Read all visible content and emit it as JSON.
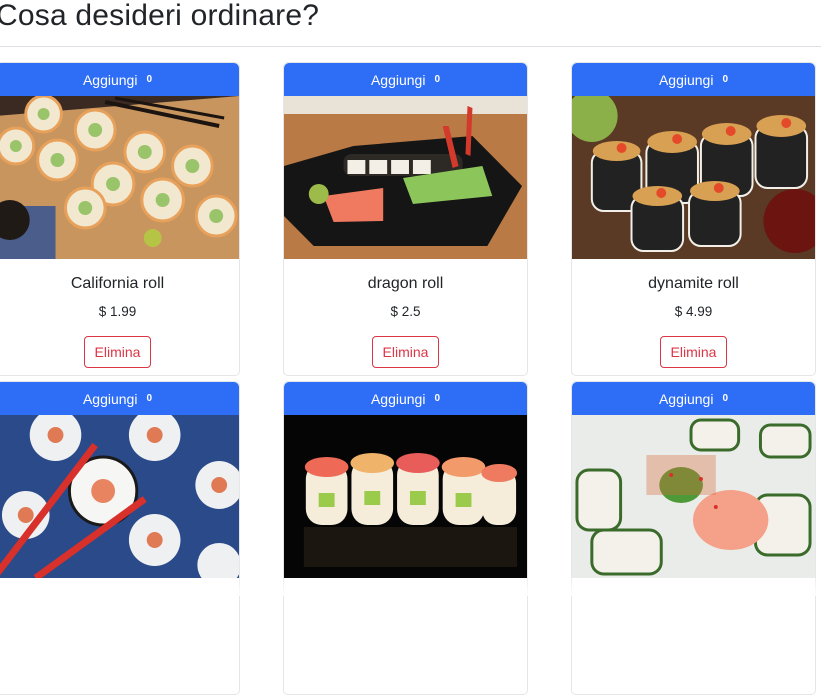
{
  "page": {
    "title": "Cosa desideri ordinare?"
  },
  "products": [
    {
      "add_label": "Aggiungi",
      "count": "0",
      "name": "California roll",
      "price": "$ 1.99",
      "delete_label": "Elimina",
      "image": "california-roll-photo"
    },
    {
      "add_label": "Aggiungi",
      "count": "0",
      "name": "dragon roll",
      "price": "$ 2.5",
      "delete_label": "Elimina",
      "image": "dragon-roll-photo"
    },
    {
      "add_label": "Aggiungi",
      "count": "0",
      "name": "dynamite roll",
      "price": "$ 4.99",
      "delete_label": "Elimina",
      "image": "dynamite-roll-photo"
    },
    {
      "add_label": "Aggiungi",
      "count": "0",
      "image": "hand-roll-chopsticks-photo"
    },
    {
      "add_label": "Aggiungi",
      "count": "0",
      "image": "rainbow-roll-photo"
    },
    {
      "add_label": "Aggiungi",
      "count": "0",
      "image": "shrimp-roll-photo"
    }
  ],
  "colors": {
    "primary": "#2e6df6",
    "danger": "#dc3545",
    "text": "#212529"
  }
}
